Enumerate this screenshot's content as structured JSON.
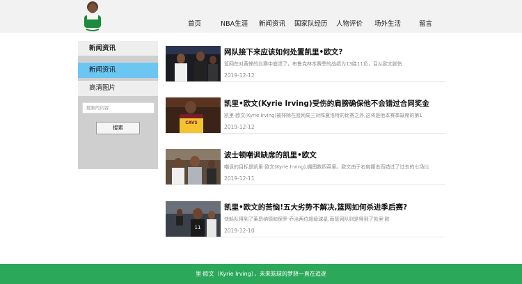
{
  "nav": {
    "items": [
      {
        "label": "首页"
      },
      {
        "label": "NBA生涯"
      },
      {
        "label": "新闻资讯"
      },
      {
        "label": "国家队经历"
      },
      {
        "label": "人物评价"
      },
      {
        "label": "场外生活"
      },
      {
        "label": "留言"
      }
    ]
  },
  "sidebar": {
    "title": "新闻资讯",
    "items": [
      {
        "label": "新闻资讯"
      },
      {
        "label": "高清图片"
      }
    ],
    "search_placeholder": "搜索的内容",
    "search_button": "搜索"
  },
  "news": [
    {
      "title": "网队接下来应该如何处置凯里•欧文?",
      "desc": "篮网在对黄蜂的比赛中崩溃了，布鲁克林本赛季的战绩为13胜11负，目从欧文脚伤",
      "date": "2019-12-12"
    },
    {
      "title": "凯里•欧文(Kyrie Irving)受伤的肩膀确保他不会错过合同奖金",
      "desc": "凯里·欧文(Kyrie Irving)被排除在篮网周三对阵夏洛特的比赛之外,这将是他本赛季缺席的第1",
      "date": "2019-12-12"
    },
    {
      "title": "波士顿嘲讽缺席的凯里•欧文",
      "desc": "嘲讽的目标是凯里·欧文(Kyrie Irving),棚图数四英里。欧文由于右肩撞击而错过了过去的七场比",
      "date": "2019-12-11"
    },
    {
      "title": "凯里•欧文的苦恼!五大劣势不解决,篮网如何杀进季后赛?",
      "desc": "快船队得到了莱昂纳德和保罗·乔治两位超级球星,而篮网队则是得到了凯里·欧",
      "date": "2019-12-10"
    }
  ],
  "footer": {
    "text": "里·欧文（Kyrie Irving），未来篮球的梦想一直在追逐"
  },
  "colors": {
    "header_bg": "#f2f2f2",
    "sidebar_bg": "#cfcfcf",
    "sidebar_active": "#6cc6f2",
    "footer_bg": "#2ca85a"
  }
}
